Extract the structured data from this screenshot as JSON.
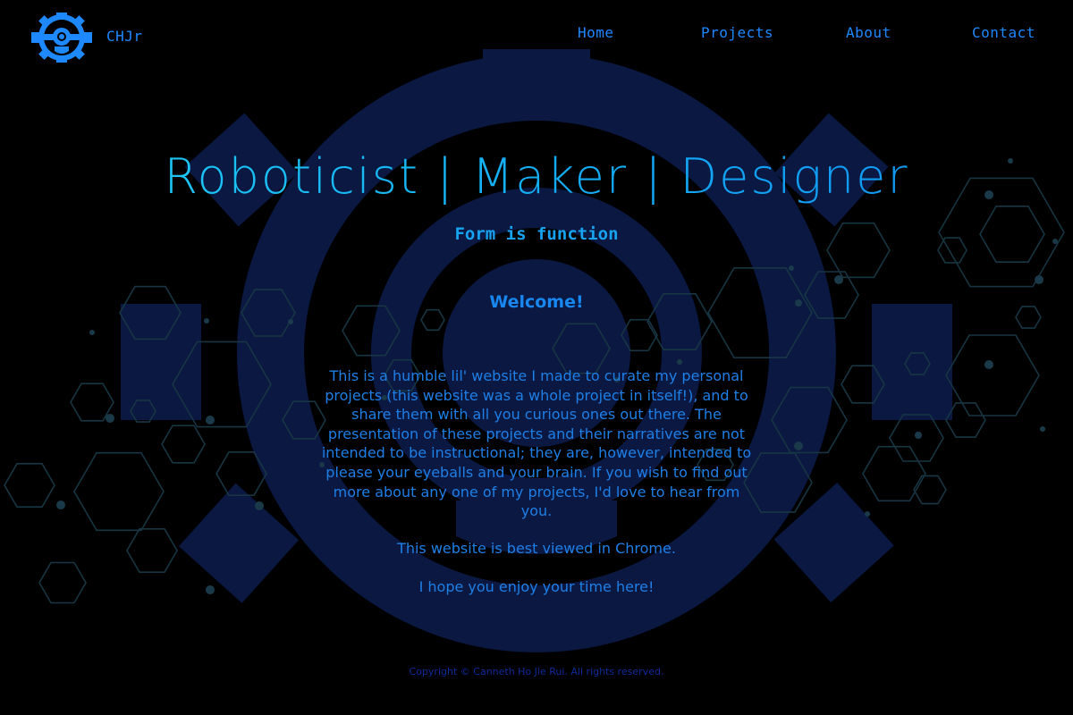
{
  "brand": {
    "name": "CHJr",
    "logo_icon": "robot-gear-icon"
  },
  "nav": {
    "items": [
      {
        "label": "Home"
      },
      {
        "label": "Projects"
      },
      {
        "label": "About"
      },
      {
        "label": "Contact"
      }
    ]
  },
  "hero": {
    "title": "Roboticist | Maker | Designer",
    "tagline": "Form is function"
  },
  "main": {
    "welcome": "Welcome!",
    "intro": "This is a humble lil' website I made to curate my personal projects (this website was a whole project in itself!), and to share them with all you curious ones out there. The presentation of these projects and their narratives are not intended to be instructional; they are, however, intended to please your eyeballs and your brain. If you wish to find out more about any one of my projects, I'd love to hear from you.",
    "browser_note": "This website is best viewed in Chrome.",
    "closing": "I hope you enjoy your time here!"
  },
  "footer": {
    "copyright": "Copyright © Canneth Ho Jie Rui. All rights reserved."
  },
  "colors": {
    "background": "#000000",
    "accent": "#1e88ff",
    "title": "#14aef4",
    "gear": "#0a1a45",
    "hex_lines": "#16323f"
  }
}
